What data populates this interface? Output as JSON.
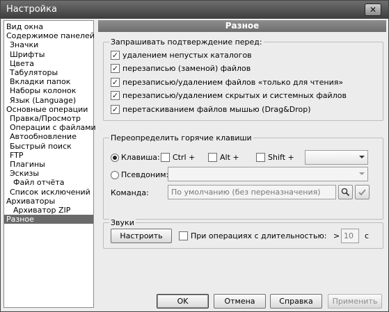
{
  "window": {
    "title": "Настройка",
    "close_glyph": "✕"
  },
  "sidebar": {
    "items": [
      {
        "label": "Вид окна",
        "indent": 0
      },
      {
        "label": "Содержимое панелей",
        "indent": 0
      },
      {
        "label": "Значки",
        "indent": 1
      },
      {
        "label": "Шрифты",
        "indent": 1
      },
      {
        "label": "Цвета",
        "indent": 1
      },
      {
        "label": "Табуляторы",
        "indent": 1
      },
      {
        "label": "Вкладки папок",
        "indent": 1
      },
      {
        "label": "Наборы колонок",
        "indent": 1
      },
      {
        "label": "Язык (Language)",
        "indent": 1
      },
      {
        "label": "Основные операции",
        "indent": 0
      },
      {
        "label": "Правка/Просмотр",
        "indent": 1
      },
      {
        "label": "Операции с файлами",
        "indent": 1
      },
      {
        "label": "Автообновление",
        "indent": 1
      },
      {
        "label": "Быстрый поиск",
        "indent": 1
      },
      {
        "label": "FTP",
        "indent": 1
      },
      {
        "label": "Плагины",
        "indent": 1
      },
      {
        "label": "Эскизы",
        "indent": 1
      },
      {
        "label": "Файл отчёта",
        "indent": 2
      },
      {
        "label": "Список исключений",
        "indent": 1
      },
      {
        "label": "Архиваторы",
        "indent": 0
      },
      {
        "label": "Архиватор ZIP",
        "indent": 2
      },
      {
        "label": "Разное",
        "indent": 0,
        "selected": true
      }
    ]
  },
  "main": {
    "header": "Разное",
    "confirm": {
      "title": "Запрашивать подтверждение перед:",
      "items": [
        {
          "label": "удалением непустых каталогов",
          "checked": true
        },
        {
          "label": "перезаписью (заменой) файлов",
          "checked": true
        },
        {
          "label": "перезаписью/удалением файлов «только для чтения»",
          "checked": true
        },
        {
          "label": "перезаписью/удалением скрытых и системных файлов",
          "checked": true
        },
        {
          "label": "перетаскиванием файлов мышью (Drag&Drop)",
          "checked": true
        }
      ]
    },
    "hotkeys": {
      "title": "Переопределить горячие клавиши",
      "key_label": "Клавиша:",
      "ctrl_label": "Ctrl +",
      "alt_label": "Alt +",
      "shift_label": "Shift +",
      "alias_label": "Псевдоним:",
      "command_label": "Команда:",
      "command_placeholder": "По умолчанию (без переназначения)"
    },
    "sounds": {
      "title": "Звуки",
      "configure_button": "Настроить",
      "duration_label": "При операциях с длительностью:",
      "gt": ">",
      "seconds_value": "10",
      "unit": "с"
    }
  },
  "footer": {
    "ok": "OK",
    "cancel": "Отмена",
    "help": "Справка",
    "apply": "Применить"
  }
}
